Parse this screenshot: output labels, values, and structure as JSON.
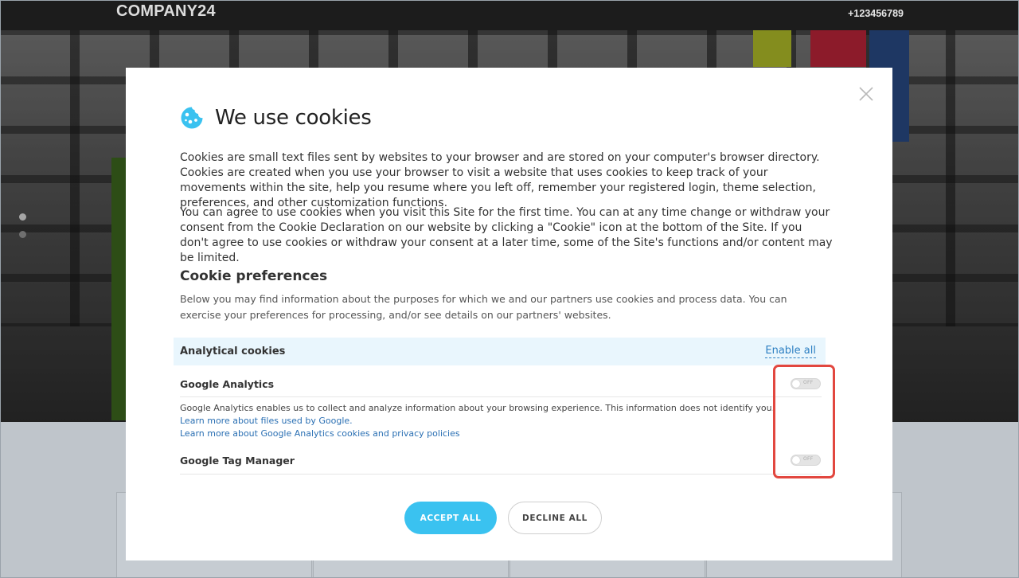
{
  "site": {
    "brand": "COMPANY24",
    "phone": "+123456789"
  },
  "modal": {
    "title": "We use cookies",
    "paragraph1": "Cookies are small text files sent by websites to your browser and are stored on your computer's browser directory. Cookies are created when you use your browser to visit a website that uses cookies to keep track of your movements within the site, help you resume where you left off, remember your registered login, theme selection, preferences, and other customization functions.",
    "paragraph2": "You can agree to use cookies when you visit this Site for the first time. You can at any time change or withdraw your consent from the Cookie Declaration on our website by clicking a \"Cookie\" icon at the bottom of the Site. If you don't agree to use cookies or withdraw your consent at a later time, some of the Site's functions and/or content may be limited.",
    "preferences": {
      "heading": "Cookie preferences",
      "description": "Below you may find information about the purposes for which we and our partners use cookies and process data. You can exercise your preferences for processing, and/or see details on our partners' websites."
    },
    "section": {
      "label": "Analytical cookies",
      "enable_all": "Enable all"
    },
    "items": [
      {
        "title": "Google Analytics",
        "toggle_state": "OFF",
        "description": "Google Analytics enables us to collect and analyze information about your browsing experience. This information does not identify you.",
        "links": [
          "Learn more about files used by Google.",
          "Learn more about Google Analytics cookies and privacy policies"
        ]
      },
      {
        "title": "Google Tag Manager",
        "toggle_state": "OFF"
      }
    ],
    "buttons": {
      "accept": "ACCEPT ALL",
      "decline": "DECLINE ALL"
    }
  },
  "colors": {
    "accent": "#3ac2f0",
    "link": "#2a6fb3",
    "highlight": "#e2473f",
    "section_bg": "#e9f6fd",
    "topbar": "#1c1c1c"
  },
  "icons": {
    "cookie": "cookie-icon",
    "close": "close-icon"
  }
}
